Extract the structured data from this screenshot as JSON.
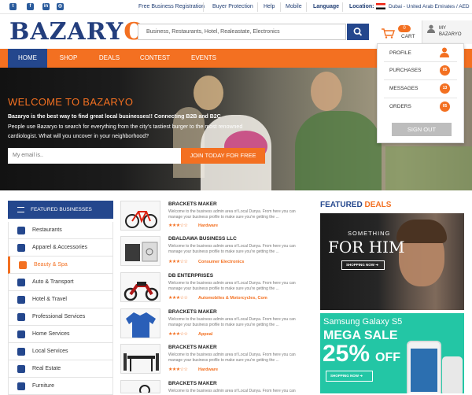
{
  "topbar": {
    "links": [
      "Free Business Registration",
      "Buyer Protection",
      "Help",
      "Mobile",
      "Language"
    ],
    "location_label": "Location:",
    "location_value": "Dubai - United Arab Emirates / AED",
    "social": [
      "twitter-icon",
      "facebook-icon",
      "linkedin-icon",
      "instagram-icon"
    ]
  },
  "header": {
    "logo_main": "BAZARY",
    "logo_accent": "O",
    "search_placeholder": "Business, Restaurants, Hotel, Realeastate, Electronics",
    "cart_count": "0",
    "cart_label": "CART",
    "account_label_1": "MY",
    "account_label_2": "BAZARYO"
  },
  "nav": {
    "items": [
      "HOME",
      "SHOP",
      "DEALS",
      "CONTEST",
      "EVENTS"
    ]
  },
  "dropdown": {
    "profile": "PROFILE",
    "purchases": "PURCHASES",
    "purchases_count": "05",
    "messages": "MESSAGES",
    "messages_count": "13",
    "orders": "ORDERS",
    "orders_count": "05",
    "signout": "SIGN OUT"
  },
  "hero": {
    "title": "WELCOME TO BAZARYO",
    "line1": "Bazaryo is the best way to find great local businesses!! Connecting B2B and B2C",
    "line2": "People use Bazaryo to search for everything from the city's tastiest burger to the most renowned",
    "line3": "cardiologist. What will you uncover in your neighborhood?",
    "email_placeholder": "My email is..",
    "join_button": "JOIN TODAY FOR FREE"
  },
  "sidebar": {
    "title": "FEATURED BUSINESSES",
    "categories": [
      "Restaurants",
      "Apparel &  Accessories",
      "Beauty & Spa",
      "Auto & Transport",
      "Hotel & Travel",
      "Professional Services",
      "Home Services",
      "Local Services",
      "Real Estate",
      "Furniture"
    ]
  },
  "listings": [
    {
      "title": "BRACKETS MAKER",
      "desc1": "Welcome to the business admin area of Local Dunya. From here you can",
      "desc2": "manage your business profile to make sure you're getting the ...",
      "stars": "★★★☆☆",
      "category": "Hardware"
    },
    {
      "title": "DBALDAWA BUSINESS LLC",
      "desc1": "Welcome to the business admin area of Local Dunya. From here you can",
      "desc2": "manage your business profile to make sure you're getting the ...",
      "stars": "★★★☆☆",
      "category": "Consumer Electronics"
    },
    {
      "title": "DB ENTERPRISES",
      "desc1": "Welcome to the business admin area of Local Dunya. From here you can",
      "desc2": "manage your business profile to make sure you're getting the ...",
      "stars": "★★★☆☆",
      "category": "Automobiles & Motorcycles, Com"
    },
    {
      "title": "BRACKETS MAKER",
      "desc1": "Welcome to the business admin area of Local Dunya. From here you can",
      "desc2": "manage your business profile to make sure you're getting the ...",
      "stars": "★★★☆☆",
      "category": "Appeal"
    },
    {
      "title": "BRACKETS MAKER",
      "desc1": "Welcome to the business admin area of Local Dunya. From here you can",
      "desc2": "manage your business profile to make sure you're getting the ...",
      "stars": "★★★☆☆",
      "category": "Hardware"
    },
    {
      "title": "BRACKETS MAKER",
      "desc1": "Welcome to the business admin area of Local Dunya. From here you can",
      "desc2": "",
      "stars": "",
      "category": ""
    }
  ],
  "deals": {
    "title_1": "FEATURED",
    "title_2": "DEALS",
    "d1_top": "SOMETHING",
    "d1_main": "FOR HIM",
    "d1_btn": "SHOPPING NOW",
    "d2_top": "Samsung Galaxy S5",
    "d2_main": "MEGA SALE",
    "d2_pct": "25%",
    "d2_off": "OFF",
    "d2_btn": "SHOPPING NOW"
  },
  "colors": {
    "brand_blue": "#24478d",
    "accent_orange": "#f37021",
    "deal_teal": "#23c6a5"
  }
}
